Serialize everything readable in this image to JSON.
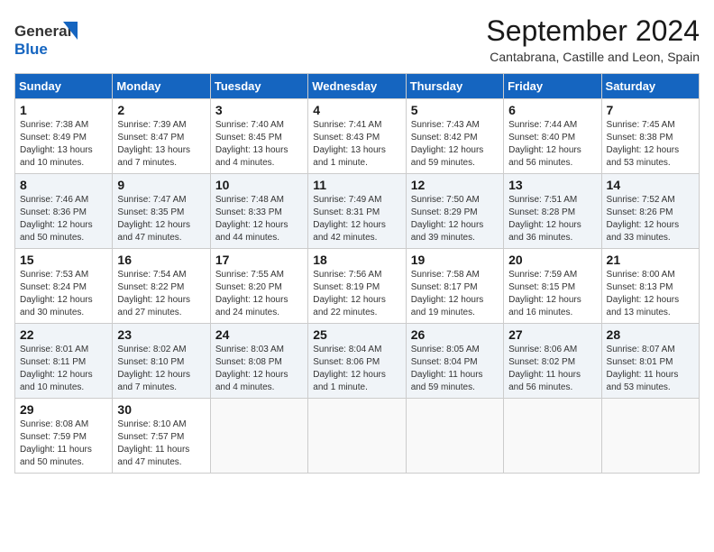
{
  "header": {
    "logo_general": "General",
    "logo_blue": "Blue",
    "month_title": "September 2024",
    "location": "Cantabrana, Castille and Leon, Spain"
  },
  "days_of_week": [
    "Sunday",
    "Monday",
    "Tuesday",
    "Wednesday",
    "Thursday",
    "Friday",
    "Saturday"
  ],
  "weeks": [
    [
      {
        "day": "1",
        "sunrise": "7:38 AM",
        "sunset": "8:49 PM",
        "daylight": "13 hours and 10 minutes."
      },
      {
        "day": "2",
        "sunrise": "7:39 AM",
        "sunset": "8:47 PM",
        "daylight": "13 hours and 7 minutes."
      },
      {
        "day": "3",
        "sunrise": "7:40 AM",
        "sunset": "8:45 PM",
        "daylight": "13 hours and 4 minutes."
      },
      {
        "day": "4",
        "sunrise": "7:41 AM",
        "sunset": "8:43 PM",
        "daylight": "13 hours and 1 minute."
      },
      {
        "day": "5",
        "sunrise": "7:43 AM",
        "sunset": "8:42 PM",
        "daylight": "12 hours and 59 minutes."
      },
      {
        "day": "6",
        "sunrise": "7:44 AM",
        "sunset": "8:40 PM",
        "daylight": "12 hours and 56 minutes."
      },
      {
        "day": "7",
        "sunrise": "7:45 AM",
        "sunset": "8:38 PM",
        "daylight": "12 hours and 53 minutes."
      }
    ],
    [
      {
        "day": "8",
        "sunrise": "7:46 AM",
        "sunset": "8:36 PM",
        "daylight": "12 hours and 50 minutes."
      },
      {
        "day": "9",
        "sunrise": "7:47 AM",
        "sunset": "8:35 PM",
        "daylight": "12 hours and 47 minutes."
      },
      {
        "day": "10",
        "sunrise": "7:48 AM",
        "sunset": "8:33 PM",
        "daylight": "12 hours and 44 minutes."
      },
      {
        "day": "11",
        "sunrise": "7:49 AM",
        "sunset": "8:31 PM",
        "daylight": "12 hours and 42 minutes."
      },
      {
        "day": "12",
        "sunrise": "7:50 AM",
        "sunset": "8:29 PM",
        "daylight": "12 hours and 39 minutes."
      },
      {
        "day": "13",
        "sunrise": "7:51 AM",
        "sunset": "8:28 PM",
        "daylight": "12 hours and 36 minutes."
      },
      {
        "day": "14",
        "sunrise": "7:52 AM",
        "sunset": "8:26 PM",
        "daylight": "12 hours and 33 minutes."
      }
    ],
    [
      {
        "day": "15",
        "sunrise": "7:53 AM",
        "sunset": "8:24 PM",
        "daylight": "12 hours and 30 minutes."
      },
      {
        "day": "16",
        "sunrise": "7:54 AM",
        "sunset": "8:22 PM",
        "daylight": "12 hours and 27 minutes."
      },
      {
        "day": "17",
        "sunrise": "7:55 AM",
        "sunset": "8:20 PM",
        "daylight": "12 hours and 24 minutes."
      },
      {
        "day": "18",
        "sunrise": "7:56 AM",
        "sunset": "8:19 PM",
        "daylight": "12 hours and 22 minutes."
      },
      {
        "day": "19",
        "sunrise": "7:58 AM",
        "sunset": "8:17 PM",
        "daylight": "12 hours and 19 minutes."
      },
      {
        "day": "20",
        "sunrise": "7:59 AM",
        "sunset": "8:15 PM",
        "daylight": "12 hours and 16 minutes."
      },
      {
        "day": "21",
        "sunrise": "8:00 AM",
        "sunset": "8:13 PM",
        "daylight": "12 hours and 13 minutes."
      }
    ],
    [
      {
        "day": "22",
        "sunrise": "8:01 AM",
        "sunset": "8:11 PM",
        "daylight": "12 hours and 10 minutes."
      },
      {
        "day": "23",
        "sunrise": "8:02 AM",
        "sunset": "8:10 PM",
        "daylight": "12 hours and 7 minutes."
      },
      {
        "day": "24",
        "sunrise": "8:03 AM",
        "sunset": "8:08 PM",
        "daylight": "12 hours and 4 minutes."
      },
      {
        "day": "25",
        "sunrise": "8:04 AM",
        "sunset": "8:06 PM",
        "daylight": "12 hours and 1 minute."
      },
      {
        "day": "26",
        "sunrise": "8:05 AM",
        "sunset": "8:04 PM",
        "daylight": "11 hours and 59 minutes."
      },
      {
        "day": "27",
        "sunrise": "8:06 AM",
        "sunset": "8:02 PM",
        "daylight": "11 hours and 56 minutes."
      },
      {
        "day": "28",
        "sunrise": "8:07 AM",
        "sunset": "8:01 PM",
        "daylight": "11 hours and 53 minutes."
      }
    ],
    [
      {
        "day": "29",
        "sunrise": "8:08 AM",
        "sunset": "7:59 PM",
        "daylight": "11 hours and 50 minutes."
      },
      {
        "day": "30",
        "sunrise": "8:10 AM",
        "sunset": "7:57 PM",
        "daylight": "11 hours and 47 minutes."
      },
      null,
      null,
      null,
      null,
      null
    ]
  ]
}
